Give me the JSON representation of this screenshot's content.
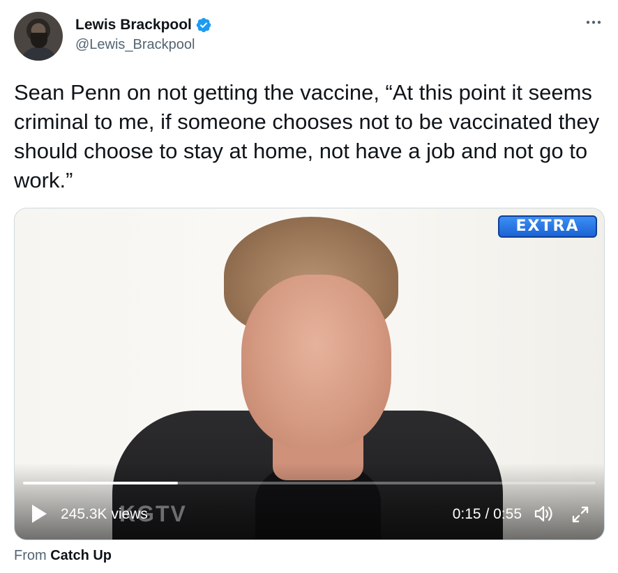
{
  "author": {
    "name": "Lewis Brackpool",
    "handle": "@Lewis_Brackpool",
    "verified": true
  },
  "more_icon": "more-horizontal-icon",
  "tweet": {
    "text": "Sean Penn on not getting the vaccine, “At this point it seems criminal to me, if someone chooses not to be vaccinated they should choose to stay at home, not have a job and not go to work.”"
  },
  "video": {
    "brand_logo": "EXTRA",
    "views": "245.3K views",
    "watermark": "KGTV",
    "current_time": "0:15",
    "separator": "/",
    "duration": "0:55",
    "progress_fraction": 0.27,
    "icons": {
      "play": "play-icon",
      "volume": "volume-icon",
      "fullscreen": "fullscreen-icon"
    }
  },
  "source": {
    "prefix": "From",
    "name": "Catch Up"
  },
  "colors": {
    "text": "#0f1419",
    "secondary": "#536471",
    "verified": "#1d9bf0",
    "extra_blue": "#1c63d4"
  }
}
